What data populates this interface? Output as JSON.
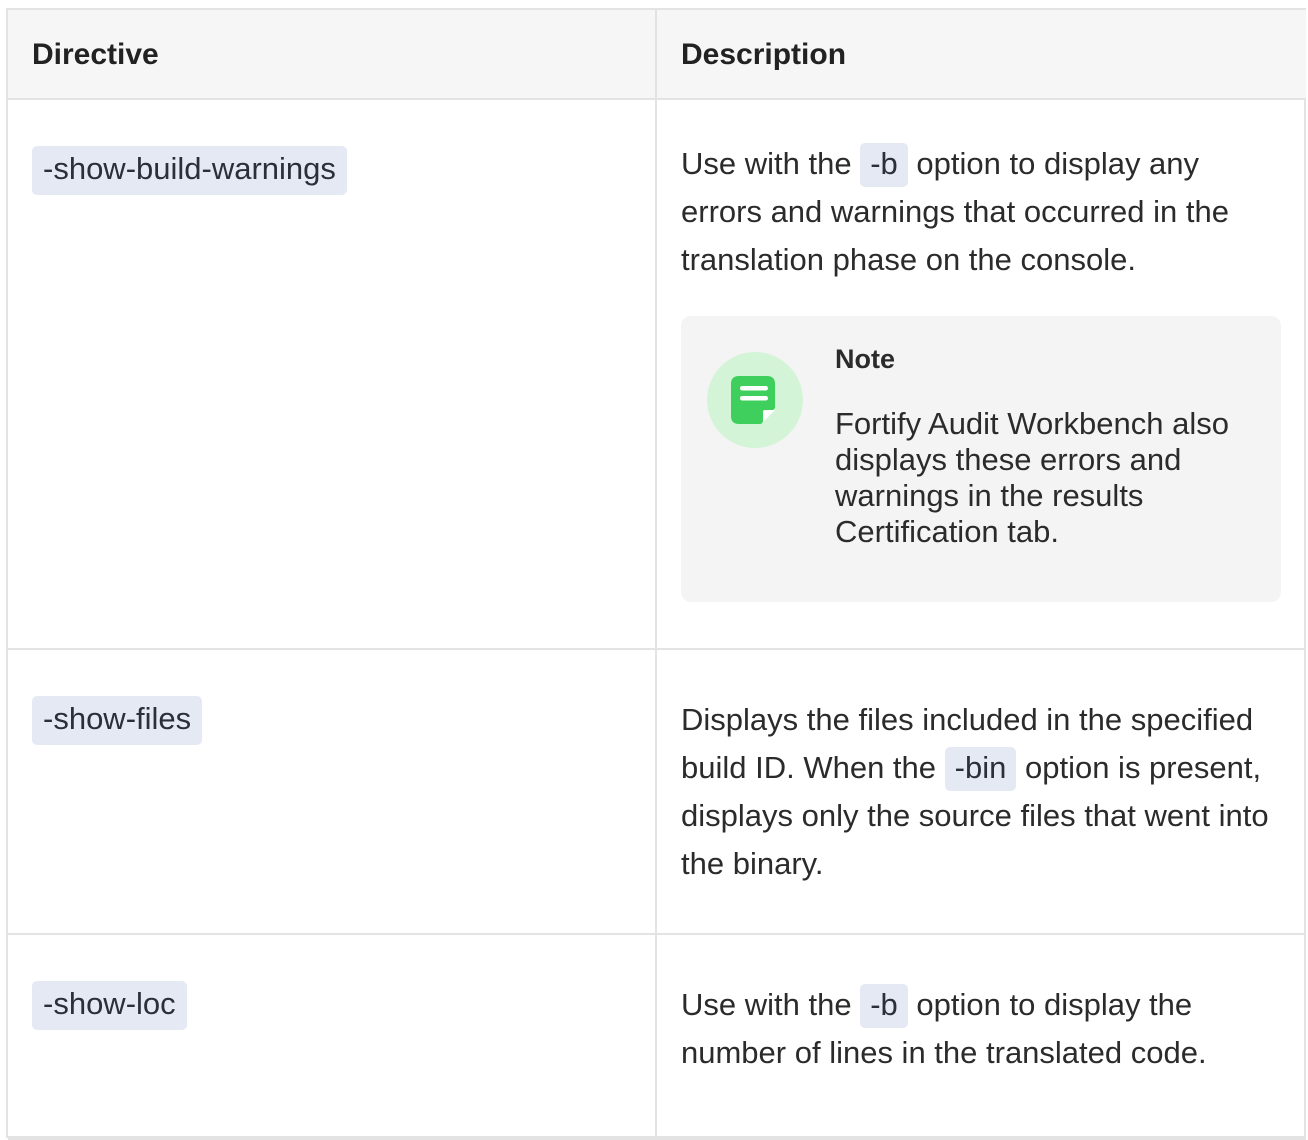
{
  "table": {
    "headers": {
      "directive": "Directive",
      "description": "Description"
    },
    "rows": [
      {
        "directive": "-show-build-warnings",
        "desc_parts": [
          "Use with the",
          "-b",
          "option to display any errors and warnings that occurred in the translation phase on the console."
        ],
        "note": {
          "title": "Note",
          "body": "Fortify Audit Workbench also displays these errors and warnings in the results Certification tab."
        }
      },
      {
        "directive": "-show-files",
        "desc_parts": [
          "Displays the files included in the specified build ID. When the",
          "-bin",
          "option is present, displays only the source files that went into the binary."
        ]
      },
      {
        "directive": "-show-loc",
        "desc_parts": [
          "Use with the",
          "-b",
          "option to display the number of lines in the translated code."
        ]
      }
    ]
  },
  "colors": {
    "code_bg": "#e4e9f4",
    "header_bg": "#f6f6f6",
    "note_bg": "#f4f4f4",
    "note_icon_circle": "#d4f4d8",
    "note_icon": "#3fcf5c"
  },
  "icons": {
    "note": "note-icon"
  }
}
